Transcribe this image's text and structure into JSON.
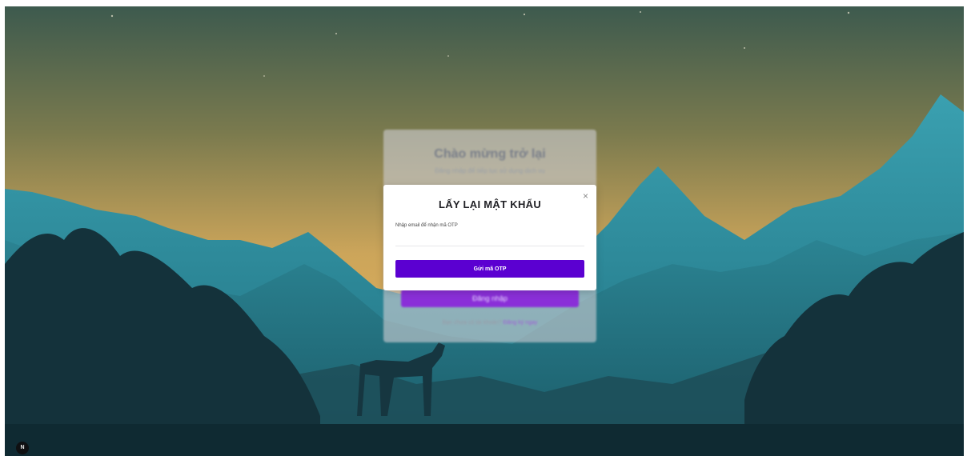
{
  "background": {
    "sky_top": "#3f5b4f",
    "sky_glow": "#c9a55a",
    "mountain": "#2f8fa0",
    "forest_dark": "#14323b"
  },
  "login_card": {
    "title": "Chào mừng trở lại",
    "subtitle": "Đăng nhập để tiếp tục sử dụng dịch vụ",
    "button_label": "Đăng nhập",
    "footer_text": "Bạn chưa có tài khoản?",
    "footer_link": "Đăng ký ngay"
  },
  "modal": {
    "title": "LẤY LẠI MẬT KHẨU",
    "close_symbol": "×",
    "email_label": "Nhập email để nhận mã OTP",
    "email_value": "",
    "email_placeholder": "",
    "submit_label": "Gửi mã OTP",
    "accent_color": "#5b00d1"
  },
  "corner_button": {
    "label": "N",
    "icon": "app-badge-icon"
  }
}
